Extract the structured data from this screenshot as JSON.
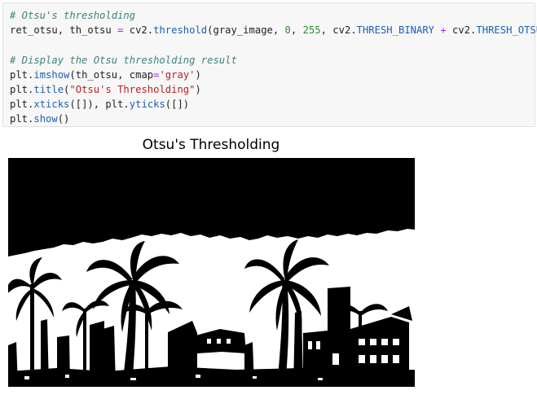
{
  "code_cell": {
    "lines": [
      [
        {
          "t": "# Otsu's thresholding",
          "c": "c-comment"
        }
      ],
      [
        {
          "t": "ret_otsu, th_otsu ",
          "c": ""
        },
        {
          "t": "=",
          "c": "c-op"
        },
        {
          "t": " cv2.",
          "c": ""
        },
        {
          "t": "threshold",
          "c": "c-attr"
        },
        {
          "t": "(gray_image, ",
          "c": ""
        },
        {
          "t": "0",
          "c": "c-num"
        },
        {
          "t": ", ",
          "c": ""
        },
        {
          "t": "255",
          "c": "c-num"
        },
        {
          "t": ", cv2.",
          "c": ""
        },
        {
          "t": "THRESH_BINARY",
          "c": "c-attr"
        },
        {
          "t": " ",
          "c": ""
        },
        {
          "t": "+",
          "c": "c-op"
        },
        {
          "t": " cv2.",
          "c": ""
        },
        {
          "t": "THRESH_OTSU",
          "c": "c-attr"
        },
        {
          "t": ")",
          "c": ""
        }
      ],
      [
        {
          "t": "",
          "c": ""
        }
      ],
      [
        {
          "t": "# Display the Otsu thresholding result",
          "c": "c-comment"
        }
      ],
      [
        {
          "t": "plt.",
          "c": ""
        },
        {
          "t": "imshow",
          "c": "c-attr"
        },
        {
          "t": "(th_otsu, cmap",
          "c": ""
        },
        {
          "t": "=",
          "c": "c-op"
        },
        {
          "t": "'gray'",
          "c": "c-str"
        },
        {
          "t": ")",
          "c": ""
        }
      ],
      [
        {
          "t": "plt.",
          "c": ""
        },
        {
          "t": "title",
          "c": "c-attr"
        },
        {
          "t": "(",
          "c": ""
        },
        {
          "t": "\"Otsu's Thresholding\"",
          "c": "c-str"
        },
        {
          "t": ")",
          "c": ""
        }
      ],
      [
        {
          "t": "plt.",
          "c": ""
        },
        {
          "t": "xticks",
          "c": "c-attr"
        },
        {
          "t": "([]), plt.",
          "c": ""
        },
        {
          "t": "yticks",
          "c": "c-attr"
        },
        {
          "t": "([])",
          "c": ""
        }
      ],
      [
        {
          "t": "plt.",
          "c": ""
        },
        {
          "t": "show",
          "c": "c-attr"
        },
        {
          "t": "()",
          "c": ""
        }
      ]
    ]
  },
  "output": {
    "plot_title": "Otsu's Thresholding",
    "image_description_icon": "binary-threshold-palm-trees-image"
  },
  "colors": {
    "cell_background": "#f7f7f7",
    "comment": "#408080",
    "attribute": "#1e5fb3",
    "number": "#2e8b2e",
    "string": "#ba2121",
    "operator": "#aa22ff"
  }
}
